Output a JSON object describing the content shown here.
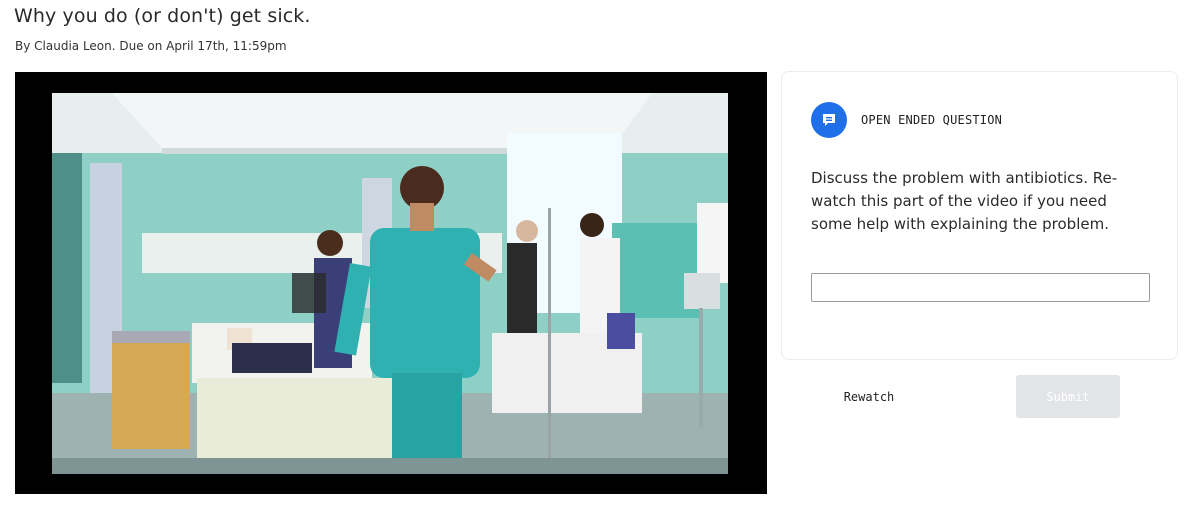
{
  "assignment": {
    "title": "Why you do (or don't) get sick.",
    "byline": "By Claudia Leon. Due on April 17th, 11:59pm"
  },
  "question": {
    "type_label": "OPEN ENDED QUESTION",
    "badge_icon": "chat-bubble-icon",
    "prompt": "Discuss the problem with antibiotics.  Re-watch this part of the video if you need some help with explaining the problem.",
    "answer_value": "",
    "answer_placeholder": ""
  },
  "actions": {
    "rewatch_label": "Rewatch",
    "submit_label": "Submit",
    "submit_enabled": false
  },
  "colors": {
    "accent": "#1f6fe8",
    "submit_disabled_bg": "#e2e4e7",
    "video_bg": "#000000"
  }
}
